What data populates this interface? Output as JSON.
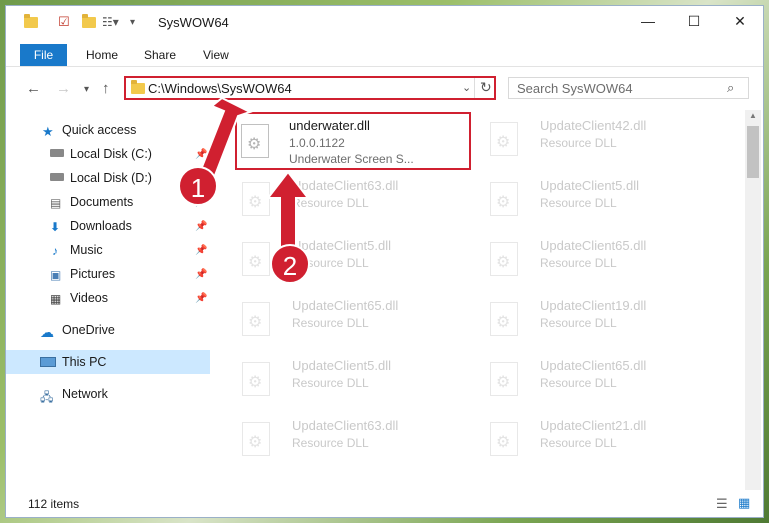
{
  "window": {
    "title": "SysWOW64",
    "controls": {
      "minimize": "—",
      "maximize": "☐",
      "close": "✕"
    }
  },
  "ribbon": {
    "file": "File",
    "tabs": [
      "Home",
      "Share",
      "View"
    ]
  },
  "address": {
    "path": "C:\\Windows\\SysWOW64"
  },
  "search": {
    "placeholder": "Search SysWOW64"
  },
  "nav_pane": {
    "items": [
      {
        "label": "Quick access",
        "icon": "star-icon",
        "pinned": false
      },
      {
        "label": "Local Disk (C:)",
        "icon": "drive-icon",
        "pinned": true
      },
      {
        "label": "Local Disk (D:)",
        "icon": "drive-icon",
        "pinned": false
      },
      {
        "label": "Documents",
        "icon": "documents-icon",
        "pinned": true
      },
      {
        "label": "Downloads",
        "icon": "download-icon",
        "pinned": true
      },
      {
        "label": "Music",
        "icon": "music-icon",
        "pinned": true
      },
      {
        "label": "Pictures",
        "icon": "pictures-icon",
        "pinned": true
      },
      {
        "label": "Videos",
        "icon": "videos-icon",
        "pinned": true
      },
      {
        "label": "OneDrive",
        "icon": "cloud-icon",
        "pinned": false
      },
      {
        "label": "This PC",
        "icon": "computer-icon",
        "pinned": false,
        "selected": true
      },
      {
        "label": "Network",
        "icon": "network-icon",
        "pinned": false
      }
    ]
  },
  "files": {
    "highlighted": {
      "name": "underwater.dll",
      "version": "1.0.0.1122",
      "description": "Underwater Screen S..."
    },
    "left_column": [
      {
        "name": "UpdateClient63.dll",
        "type": "Resource DLL"
      },
      {
        "name": "UpdateClient5.dll",
        "type": "Resource DLL"
      },
      {
        "name": "UpdateClient65.dll",
        "type": "Resource DLL"
      },
      {
        "name": "UpdateClient5.dll",
        "type": "Resource DLL"
      },
      {
        "name": "UpdateClient63.dll",
        "type": "Resource DLL"
      }
    ],
    "right_column": [
      {
        "name": "UpdateClient42.dll",
        "type": "Resource DLL"
      },
      {
        "name": "UpdateClient5.dll",
        "type": "Resource DLL"
      },
      {
        "name": "UpdateClient65.dll",
        "type": "Resource DLL"
      },
      {
        "name": "UpdateClient19.dll",
        "type": "Resource DLL"
      },
      {
        "name": "UpdateClient65.dll",
        "type": "Resource DLL"
      },
      {
        "name": "UpdateClient21.dll",
        "type": "Resource DLL"
      }
    ]
  },
  "status": {
    "count": "112 items"
  },
  "annotations": {
    "step1": "1",
    "step2": "2"
  },
  "colors": {
    "accent": "#1979ca",
    "highlight": "#d02030",
    "selected": "#cce8ff"
  }
}
